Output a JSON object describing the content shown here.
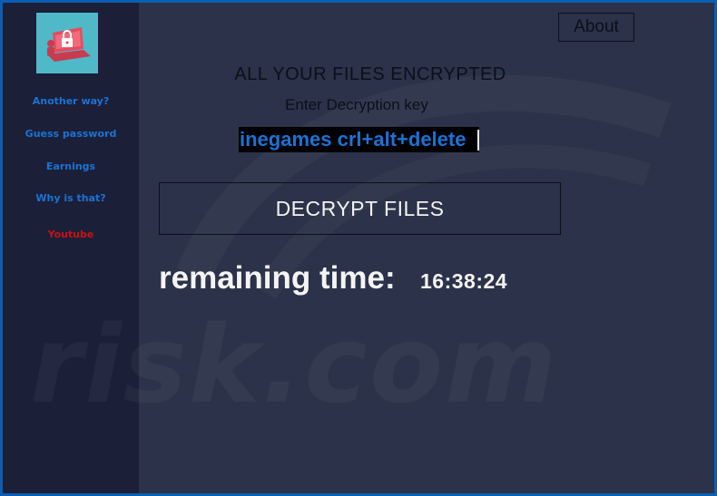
{
  "header": {
    "about_label": "About"
  },
  "main": {
    "headline": "ALL YOUR FILES ENCRYPTED",
    "prompt": "Enter Decryption key",
    "key_value": "inegames crl+alt+delete",
    "decrypt_label": "DECRYPT FILES",
    "remaining_label": "remaining time:",
    "remaining_value": "16:38:24"
  },
  "sidebar": {
    "logo_icon": "ransomware-lock-icon",
    "items": [
      {
        "label": "Another way?",
        "color": "#1a73d6"
      },
      {
        "label": "Guess password",
        "color": "#1a73d6"
      },
      {
        "label": "Earnings",
        "color": "#1a73d6"
      },
      {
        "label": "Why is that?",
        "color": "#1a73d6"
      },
      {
        "label": "Youtube",
        "color": "#c41414"
      }
    ]
  },
  "watermark": {
    "text": "risk.com"
  },
  "colors": {
    "frame": "#0a5fb4",
    "background": "#2b3249",
    "sidebar": "#1b1f38",
    "accent_blue": "#1a73d6",
    "accent_red": "#c41414",
    "logo_bg": "#4fb9c8"
  }
}
